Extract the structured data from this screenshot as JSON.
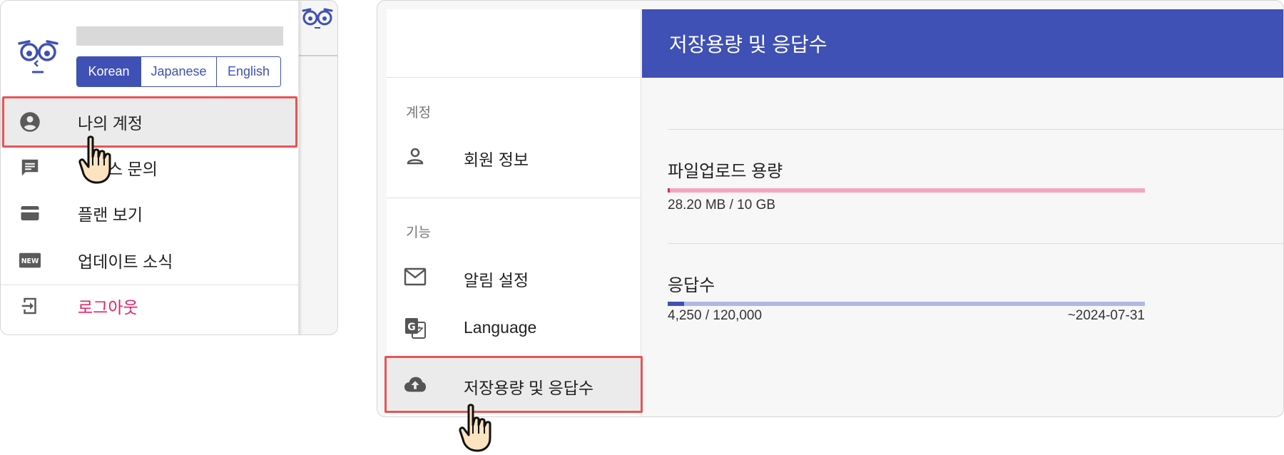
{
  "left_panel": {
    "user_name_placeholder": "",
    "languages": [
      "Korean",
      "Japanese",
      "English"
    ],
    "active_language": "Korean",
    "menu": [
      {
        "label": "나의 계정",
        "icon": "account-circle-icon"
      },
      {
        "label": "스 문의",
        "icon": "chat-icon"
      },
      {
        "label": "플랜 보기",
        "icon": "credit-card-icon"
      },
      {
        "label": "업데이트 소식",
        "icon": "new-badge-icon"
      },
      {
        "label": "로그아웃",
        "icon": "logout-icon"
      }
    ],
    "new_badge_text": "NEW"
  },
  "right_panel": {
    "sidebar": {
      "section_account": "계정",
      "item_member_info": "회원 정보",
      "section_features": "기능",
      "item_notifications": "알림 설정",
      "item_language": "Language",
      "item_storage": "저장용량 및 응답수"
    },
    "header_title": "저장용량 및 응답수",
    "upload": {
      "title": "파일업로드 용량",
      "usage_text": "28.20 MB / 10 GB",
      "fraction": 0.0028
    },
    "responses": {
      "title": "응답수",
      "usage_text": "4,250 / 120,000",
      "expiry": "~2024-07-31",
      "fraction": 0.035
    }
  },
  "colors": {
    "primary": "#3f51b5",
    "highlight_box": "#e95555",
    "upload_bar": "#f4a7bf",
    "upload_fill": "#e91e63",
    "responses_bar": "#b0b8e6",
    "responses_fill": "#3f51b5",
    "logout": "#e91e63"
  }
}
